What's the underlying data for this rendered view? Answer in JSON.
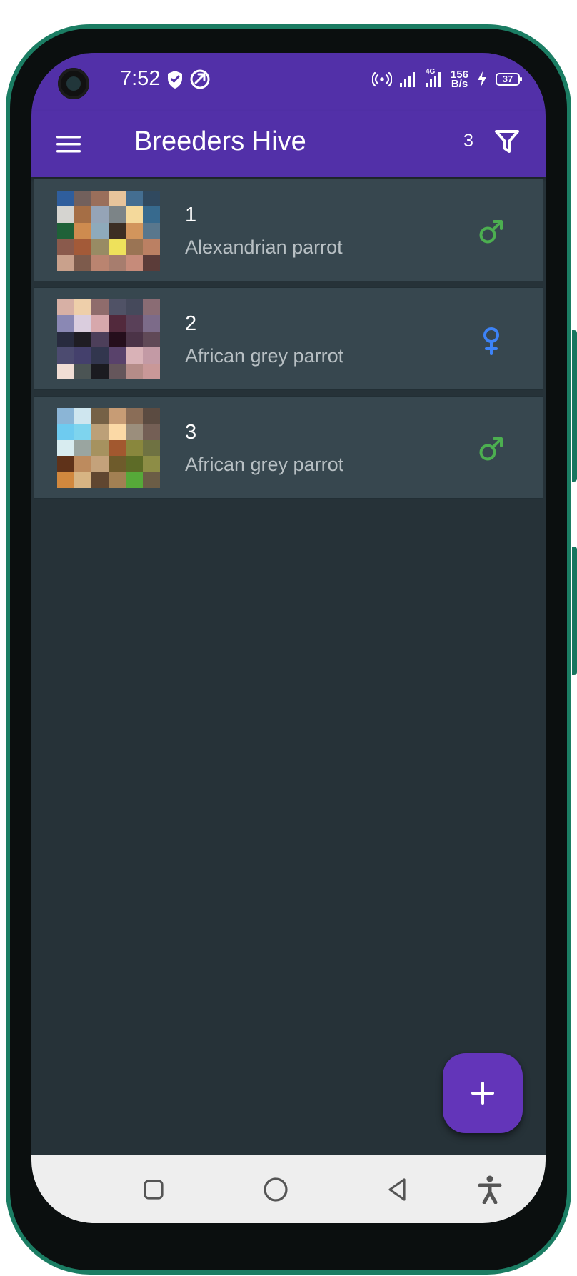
{
  "status_bar": {
    "time": "7:52",
    "network_type": "4G",
    "speed_value": "156",
    "speed_unit": "B/s",
    "battery_level": "37",
    "icons": [
      "shield-icon",
      "assistant-icon",
      "hotspot-icon",
      "signal-icon",
      "signal-4g-icon",
      "charging-icon",
      "battery-icon"
    ]
  },
  "app_bar": {
    "title": "Breeders Hive",
    "filter_count": "3",
    "icons": [
      "menu-icon",
      "filter-icon"
    ]
  },
  "birds": [
    {
      "number": "1",
      "species": "Alexandrian parrot",
      "gender": "male",
      "gender_icon": "male-icon",
      "gender_color": "#4caf50"
    },
    {
      "number": "2",
      "species": "African grey parrot",
      "gender": "female",
      "gender_icon": "female-icon",
      "gender_color": "#3d83f7"
    },
    {
      "number": "3",
      "species": "African grey parrot",
      "gender": "male",
      "gender_icon": "male-icon",
      "gender_color": "#4caf50"
    }
  ],
  "fab": {
    "icon": "plus-icon",
    "color": "#6335b9"
  },
  "navigation": {
    "items": [
      "recent-apps-icon",
      "home-icon",
      "back-icon",
      "accessibility-icon"
    ]
  },
  "colors": {
    "primary": "#5230a8",
    "background": "#263238",
    "list_item": "#37474f",
    "male": "#4caf50",
    "female": "#3d83f7",
    "navigation": "#eeeeee"
  }
}
